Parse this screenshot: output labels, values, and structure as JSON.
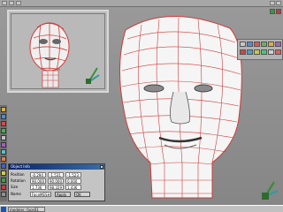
{
  "app": {
    "name": "3D modeling workspace"
  },
  "taskbar": {
    "item_label": "modeler: face01"
  },
  "dialog": {
    "title": "Object Info",
    "rows": [
      {
        "label": "Position",
        "v1": "-0.294",
        "v2": "-1.531",
        "v3": "-1.523"
      },
      {
        "label": "Rotation",
        "v1": "90.000",
        "v2": "90.000",
        "v3": "0.000"
      },
      {
        "label": "Size",
        "v1": "1.736",
        "v2": "98.329",
        "v3": "1.436"
      }
    ],
    "name_label": "Name",
    "name_value": "FaceMESH",
    "buttons": [
      "Apply",
      "OK"
    ]
  },
  "colors": {
    "mesh": "#e23d3d",
    "skin": "#f4f4f4",
    "background": "#8c8c8c",
    "dialog_title": "#0a246a"
  }
}
